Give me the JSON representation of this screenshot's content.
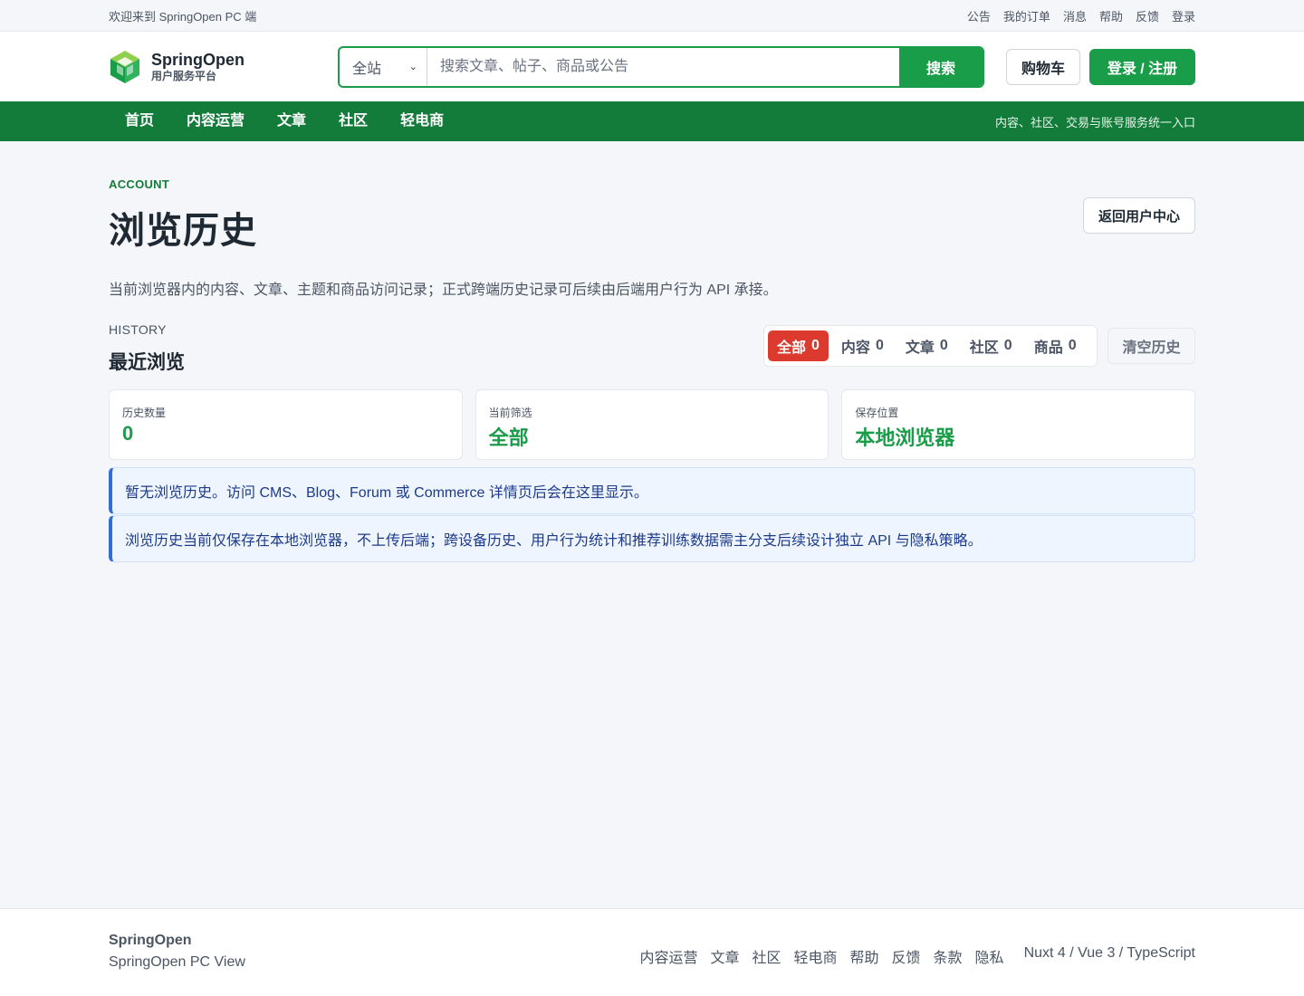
{
  "topbar": {
    "welcome": "欢迎来到 SpringOpen PC 端",
    "links": [
      "公告",
      "我的订单",
      "消息",
      "帮助",
      "反馈",
      "登录"
    ]
  },
  "header": {
    "brand": "SpringOpen",
    "subtitle": "用户服务平台",
    "search": {
      "scope": "全站",
      "placeholder": "搜索文章、帖子、商品或公告",
      "value": "",
      "button": "搜索"
    },
    "cart_label": "购物车",
    "login_label": "登录 / 注册"
  },
  "nav": {
    "items": [
      "首页",
      "内容运营",
      "文章",
      "社区",
      "轻电商"
    ],
    "tagline": "内容、社区、交易与账号服务统一入口"
  },
  "page": {
    "eyebrow": "ACCOUNT",
    "title": "浏览历史",
    "back_label": "返回用户中心",
    "description": "当前浏览器内的内容、文章、主题和商品访问记录；正式跨端历史记录可后续由后端用户行为 API 承接。"
  },
  "history": {
    "eyebrow": "HISTORY",
    "title": "最近浏览",
    "filters": [
      {
        "label": "全部",
        "count": "0",
        "active": true
      },
      {
        "label": "内容",
        "count": "0",
        "active": false
      },
      {
        "label": "文章",
        "count": "0",
        "active": false
      },
      {
        "label": "社区",
        "count": "0",
        "active": false
      },
      {
        "label": "商品",
        "count": "0",
        "active": false
      }
    ],
    "clear_label": "清空历史",
    "stats": [
      {
        "label": "历史数量",
        "value": "0"
      },
      {
        "label": "当前筛选",
        "value": "全部"
      },
      {
        "label": "保存位置",
        "value": "本地浏览器"
      }
    ],
    "empty_notice": "暂无浏览历史。访问 CMS、Blog、Forum 或 Commerce 详情页后会在这里显示。",
    "storage_notice": "浏览历史当前仅保存在本地浏览器，不上传后端；跨设备历史、用户行为统计和推荐训练数据需主分支后续设计独立 API 与隐私策略。"
  },
  "footer": {
    "brand": "SpringOpen",
    "subtitle": "SpringOpen PC View",
    "links": [
      "内容运营",
      "文章",
      "社区",
      "轻电商",
      "帮助",
      "反馈",
      "条款",
      "隐私"
    ],
    "tech": "Nuxt 4 / Vue 3 / TypeScript"
  },
  "colors": {
    "brand_green": "#1a9d49",
    "nav_green": "#147c3b",
    "active_filter": "#dc3a2e",
    "notice_accent": "#2f6fdb"
  }
}
